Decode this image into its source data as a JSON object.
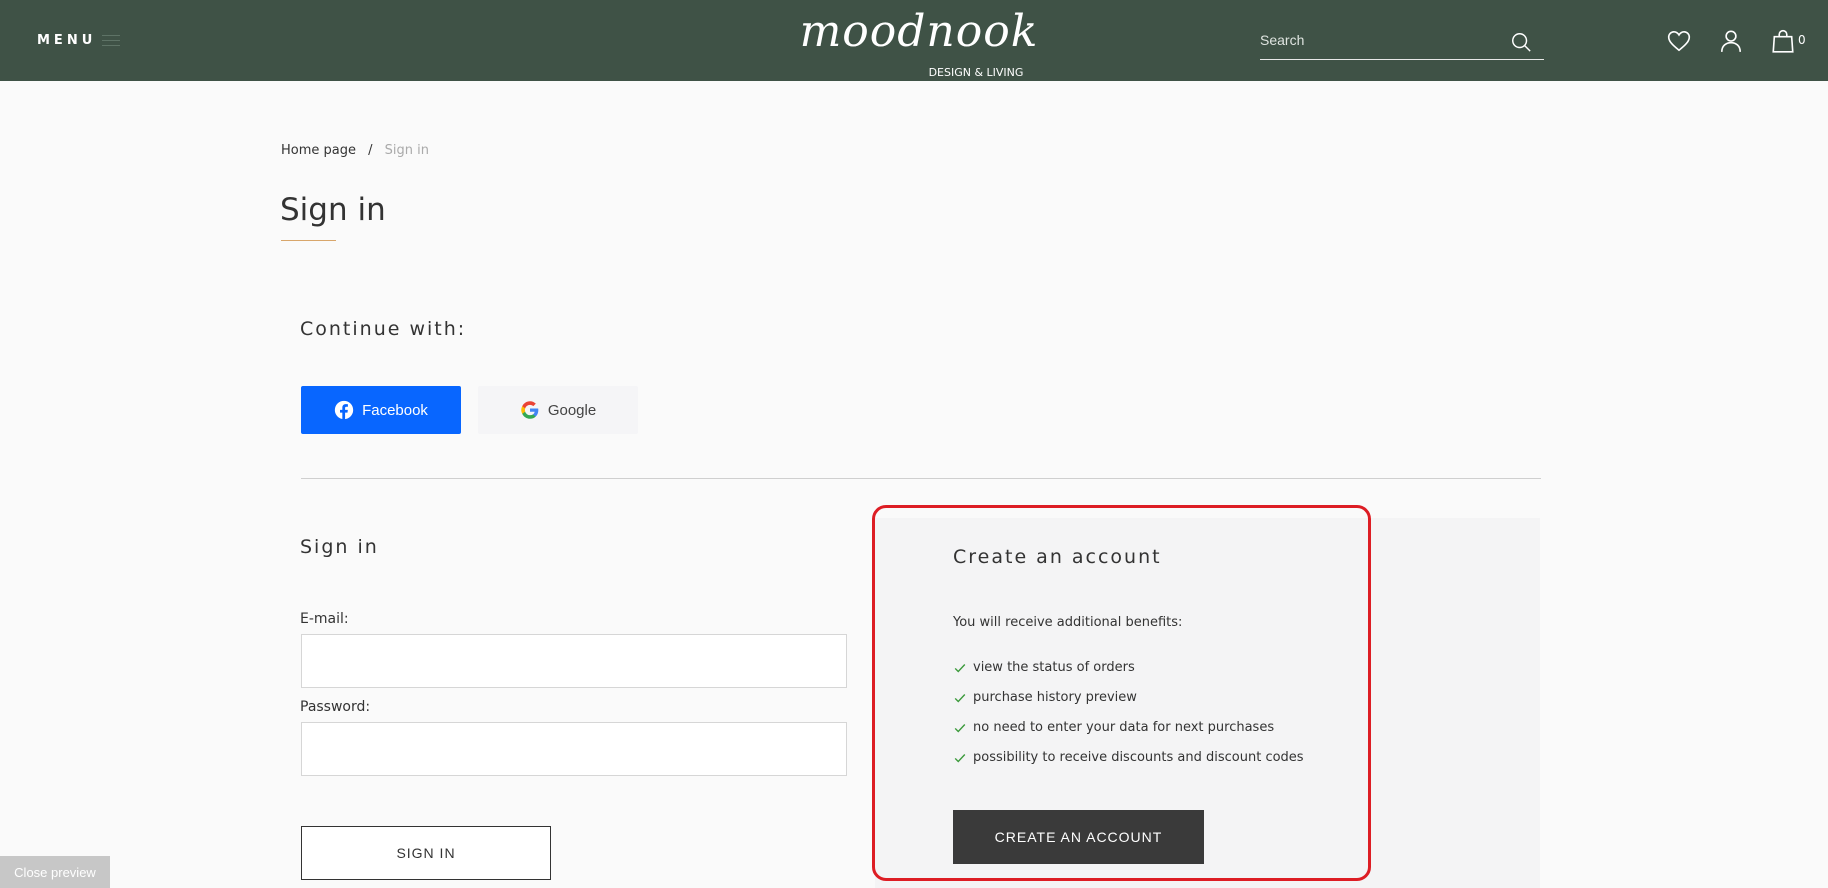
{
  "header": {
    "menu_label": "MENU",
    "logo_script": "moodnook",
    "logo_sub": "DESIGN & LIVING",
    "search_placeholder": "Search",
    "cart_count": "0"
  },
  "breadcrumb": {
    "home": "Home page",
    "separator": "/",
    "current": "Sign in"
  },
  "page_title": "Sign in",
  "social": {
    "heading": "Continue with:",
    "facebook_label": "Facebook",
    "google_label": "Google"
  },
  "signin": {
    "heading": "Sign in",
    "email_label": "E-mail:",
    "email_value": "",
    "password_label": "Password:",
    "password_value": "",
    "submit_label": "SIGN IN"
  },
  "create_account": {
    "heading": "Create an account",
    "intro": "You will receive additional benefits:",
    "benefits": [
      "view the status of orders",
      "purchase history preview",
      "no need to enter your data for next purchases",
      "possibility to receive discounts and discount codes"
    ],
    "button_label": "CREATE AN ACCOUNT"
  },
  "close_preview": "Close preview",
  "colors": {
    "header_bg": "#3f5246",
    "facebook_blue": "#0866ff",
    "highlight_red": "#dd1d24",
    "check_green": "#3c9a3c",
    "accent_underline": "#d8a66b"
  },
  "icons": {
    "search": "search-icon",
    "wishlist": "heart-icon",
    "account": "user-icon",
    "cart": "shopping-bag-icon",
    "benefit": "check-icon"
  }
}
